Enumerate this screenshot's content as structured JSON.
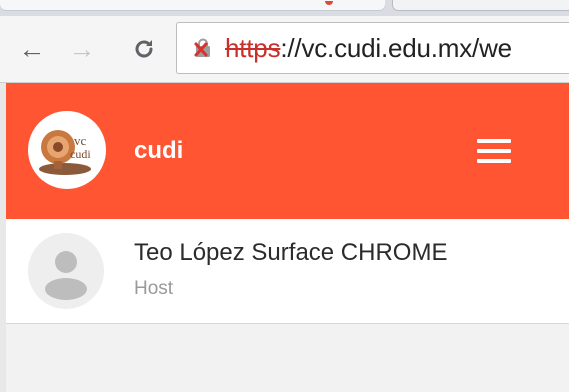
{
  "browser": {
    "url_scheme": "https",
    "url_rest": "://vc.cudi.edu.mx/we",
    "nav": {
      "back_icon": "←",
      "forward_icon": "→",
      "reload_icon": "C"
    }
  },
  "header": {
    "logo_text_top": "vc",
    "logo_text_bottom": "cudi",
    "title": "cudi",
    "menu_icon": "hamburger-icon"
  },
  "participants": [
    {
      "name": "Teo López Surface CHROME",
      "role": "Host"
    }
  ],
  "colors": {
    "header": "#ff5533",
    "scheme_error": "#c9302c"
  }
}
